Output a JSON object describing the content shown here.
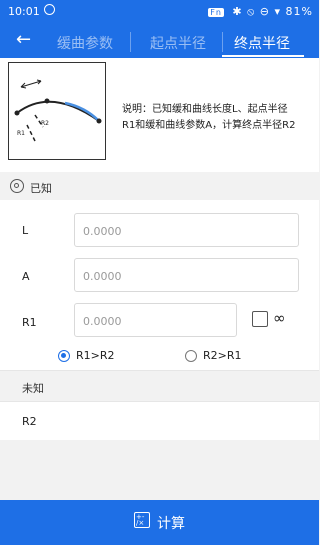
{
  "status_bar": {
    "time": "10:01",
    "fn_badge": "Fn",
    "icons_text": "✱ ⦸ ⊖ ▾",
    "battery": "81%"
  },
  "nav": {
    "back_glyph": "←",
    "tabs": [
      {
        "label": "缓曲参数",
        "active": false
      },
      {
        "label": "起点半径",
        "active": false
      },
      {
        "label": "终点半径",
        "active": true
      }
    ]
  },
  "description": {
    "diagram_labels": {
      "r1": "R1",
      "r2": "R2"
    },
    "text_line1": "说明：已知缓和曲线长度L、起点半径",
    "text_line2": "R1和缓和曲线参数A，计算终点半径R2"
  },
  "known_section": {
    "title": "已知"
  },
  "fields": [
    {
      "label": "L",
      "value": "0.0000"
    },
    {
      "label": "A",
      "value": "0.0000"
    },
    {
      "label": "R1",
      "value": "0.0000"
    }
  ],
  "infinity_symbol": "∞",
  "radio_options": [
    {
      "label": "R1>R2",
      "selected": true
    },
    {
      "label": "R2>R1",
      "selected": false
    }
  ],
  "unknown_section": {
    "title": "未知"
  },
  "result": {
    "label": "R2",
    "value": ""
  },
  "calculate_button": {
    "label": "计算"
  },
  "colors": {
    "primary": "#1e6fe6",
    "background": "#f2f2f2"
  }
}
